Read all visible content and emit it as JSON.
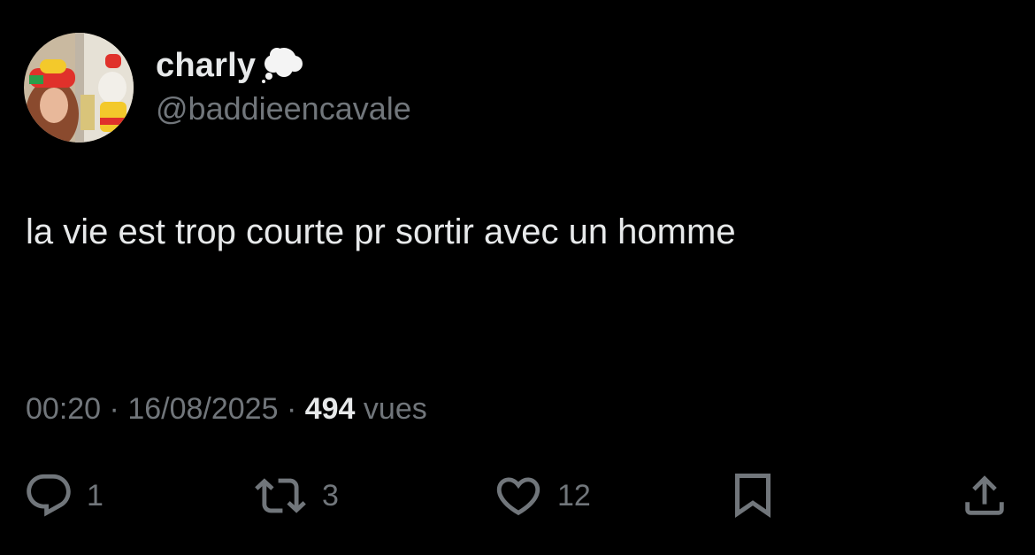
{
  "author": {
    "display_name": "charly",
    "handle": "@baddieencavale",
    "name_emoji": "thought-balloon-icon"
  },
  "tweet": {
    "text": "la vie est trop courte pr sortir avec un homme"
  },
  "meta": {
    "time": "00:20",
    "separator": "·",
    "date": "16/08/2025",
    "views_count": "494",
    "views_label": "vues"
  },
  "actions": {
    "reply": {
      "icon": "reply-icon",
      "count": "1"
    },
    "retweet": {
      "icon": "retweet-icon",
      "count": "3"
    },
    "like": {
      "icon": "heart-icon",
      "count": "12"
    },
    "bookmark": {
      "icon": "bookmark-icon"
    },
    "share": {
      "icon": "share-icon"
    }
  },
  "colors": {
    "background": "#000000",
    "primary_text": "#e7e9ea",
    "secondary_text": "#71767b"
  }
}
